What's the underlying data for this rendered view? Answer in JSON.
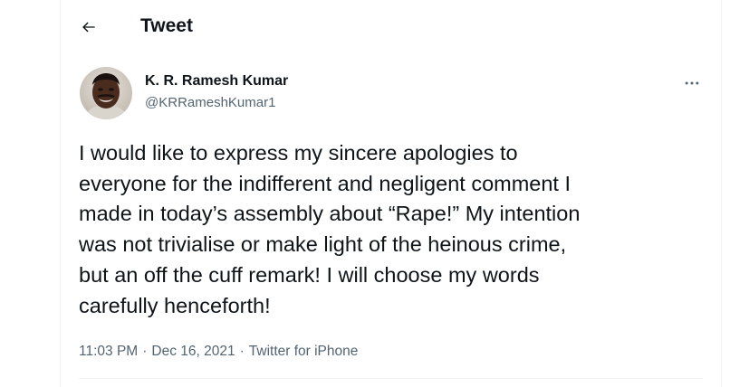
{
  "header": {
    "title": "Tweet",
    "back_icon": "arrow-left-icon"
  },
  "author": {
    "name": "K. R. Ramesh Kumar",
    "handle": "@KRRameshKumar1",
    "avatar_icon": "avatar-photo"
  },
  "more_icon": "more-horizontal-icon",
  "tweet": {
    "text": "I would like to express my sincere apologies to\neveryone for the indifferent and negligent comment I\nmade in today’s assembly about “Rape!” My intention\nwas not trivialise or make light of the heinous crime,\nbut an off the cuff remark! I will choose my words\ncarefully henceforth!"
  },
  "meta": {
    "time": "11:03 PM",
    "date": "Dec 16, 2021",
    "source": "Twitter for iPhone",
    "separator": "·"
  },
  "colors": {
    "text_primary": "#0f1419",
    "text_secondary": "#536471",
    "border": "#eff3f4"
  }
}
